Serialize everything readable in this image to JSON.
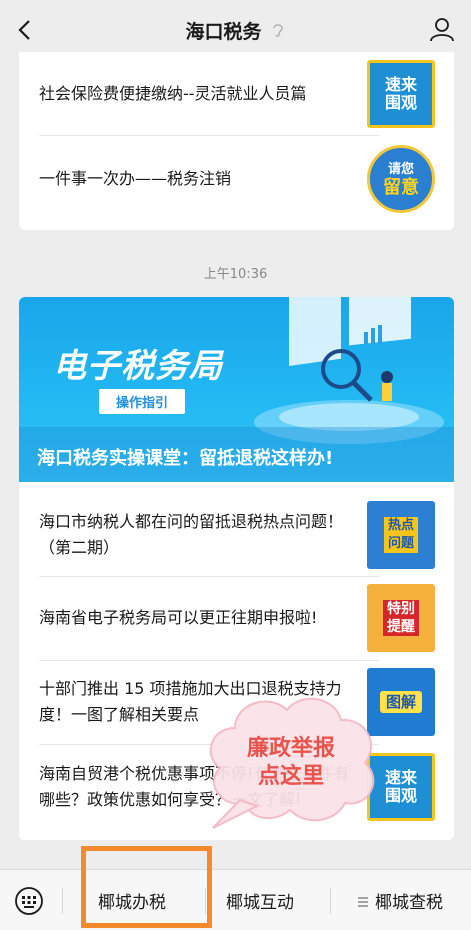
{
  "header": {
    "title": "海口税务"
  },
  "card1": {
    "items": [
      {
        "text": "社会保险费便捷缴纳--灵活就业人员篇",
        "thumb": [
          "速来",
          "围观"
        ]
      },
      {
        "text": "一件事一次办——税务注销",
        "thumb": [
          "请您",
          "留意"
        ]
      }
    ]
  },
  "time": "上午10:36",
  "card2": {
    "banner_title": "电子税务局",
    "banner_button": "操作指引",
    "banner_caption": "海口税务实操课堂：留抵退税这样办!",
    "items": [
      {
        "text": "海口市纳税人都在问的留抵退税热点问题！（第二期）",
        "thumb": [
          "热点",
          "问题"
        ]
      },
      {
        "text": "海南省电子税务局可以更正往期申报啦!",
        "thumb": [
          "特别",
          "提醒"
        ]
      },
      {
        "text": "十部门推出 15 项措施加大出口退税支持力度！一图了解相关要点",
        "thumb": [
          "图解"
        ]
      },
      {
        "text": "海南自贸港个税优惠事项不停!有哪些条件有哪些？政策优惠如何享受？一文了解!",
        "thumb": [
          "速来",
          "围观"
        ]
      }
    ]
  },
  "overlay": {
    "text_line1": "廉政举报",
    "text_line2": "点这里"
  },
  "menu": {
    "items": [
      "椰城办税",
      "椰城互动",
      "椰城查税"
    ]
  },
  "colors": {
    "highlight": "#f58a2c",
    "cloud_text": "#e8534b"
  }
}
